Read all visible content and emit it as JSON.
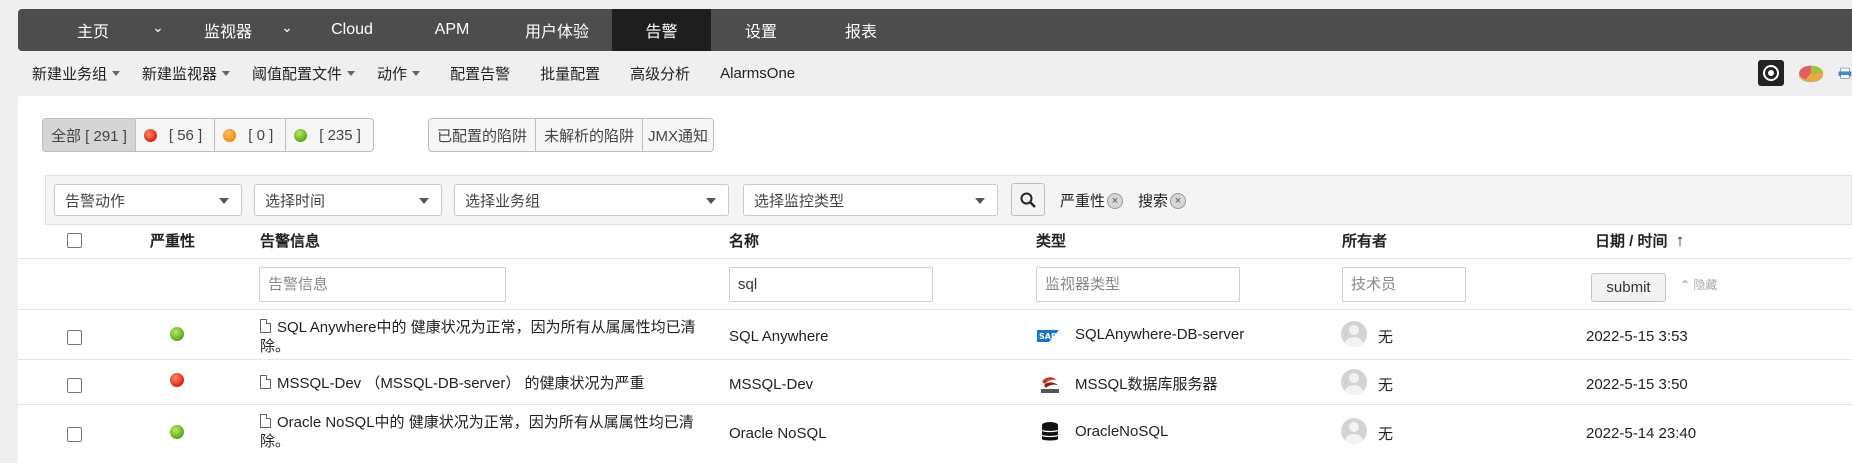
{
  "top_nav": {
    "items": [
      {
        "label": "主页",
        "has_caret": true
      },
      {
        "label": "监视器",
        "has_caret": true
      },
      {
        "label": "Cloud"
      },
      {
        "label": "APM"
      },
      {
        "label": "用户体验"
      },
      {
        "label": "告警",
        "active": true
      },
      {
        "label": "设置"
      },
      {
        "label": "报表"
      }
    ],
    "caret_glyph": "⌄"
  },
  "sub_nav": {
    "items": [
      {
        "label": "新建业务组",
        "dropdown": true
      },
      {
        "label": "新建监视器",
        "dropdown": true
      },
      {
        "label": "阈值配置文件",
        "dropdown": true
      },
      {
        "label": "动作",
        "dropdown": true
      },
      {
        "label": "配置告警"
      },
      {
        "label": "批量配置"
      },
      {
        "label": "高级分析"
      },
      {
        "label": "AlarmsOne"
      }
    ],
    "tool_icons": [
      "camera-icon",
      "pie-chart-icon",
      "printer-icon"
    ]
  },
  "status_filter": {
    "all": "全部 [ 291 ]",
    "critical": "[ 56 ]",
    "warning": "[ 0 ]",
    "clear": "[ 235 ]"
  },
  "trap_tabs": [
    "已配置的陷阱",
    "未解析的陷阱",
    "JMX通知"
  ],
  "filters": {
    "action_select": "告警动作",
    "time_select": "选择时间",
    "group_select": "选择业务组",
    "monitor_type_select": "选择监控类型",
    "severity_tag": "严重性",
    "search_tag": "搜索",
    "remove_glyph": "×"
  },
  "table": {
    "headers": {
      "severity": "严重性",
      "message": "告警信息",
      "name": "名称",
      "type": "类型",
      "owner": "所有者",
      "datetime": "日期 / 时间",
      "sort_glyph": "↑"
    },
    "filter_inputs": {
      "message_placeholder": "告警信息",
      "name_value": "sql",
      "type_placeholder": "监视器类型",
      "owner_placeholder": "技术员"
    },
    "submit_label": "submit",
    "hide_label": "隐藏",
    "rows": [
      {
        "severity": "clear",
        "message_line1": "SQL Anywhere中的 健康状况为正常，因为所有从属属性均已清",
        "message_line2": "除。",
        "name": "SQL Anywhere",
        "type": "SQLAnywhere-DB-server",
        "type_icon": "sap-icon",
        "owner": "无",
        "datetime": "2022-5-15 3:53"
      },
      {
        "severity": "critical",
        "message_line1": "MSSQL-Dev （MSSQL-DB-server） 的健康状况为严重",
        "message_line2": "",
        "name": "MSSQL-Dev",
        "type": "MSSQL数据库服务器",
        "type_icon": "sql-server-icon",
        "owner": "无",
        "datetime": "2022-5-15 3:50"
      },
      {
        "severity": "clear",
        "message_line1": "Oracle NoSQL中的 健康状况为正常，因为所有从属属性均已清",
        "message_line2": "除。",
        "name": "Oracle NoSQL",
        "type": "OracleNoSQL",
        "type_icon": "database-icon",
        "owner": "无",
        "datetime": "2022-5-14 23:40"
      }
    ]
  },
  "colors": {
    "critical": "#e0200b",
    "warning": "#f28a10",
    "clear": "#5aa813",
    "topbar_bg": "#4d4d4d",
    "topbar_active": "#1e1e1e"
  }
}
